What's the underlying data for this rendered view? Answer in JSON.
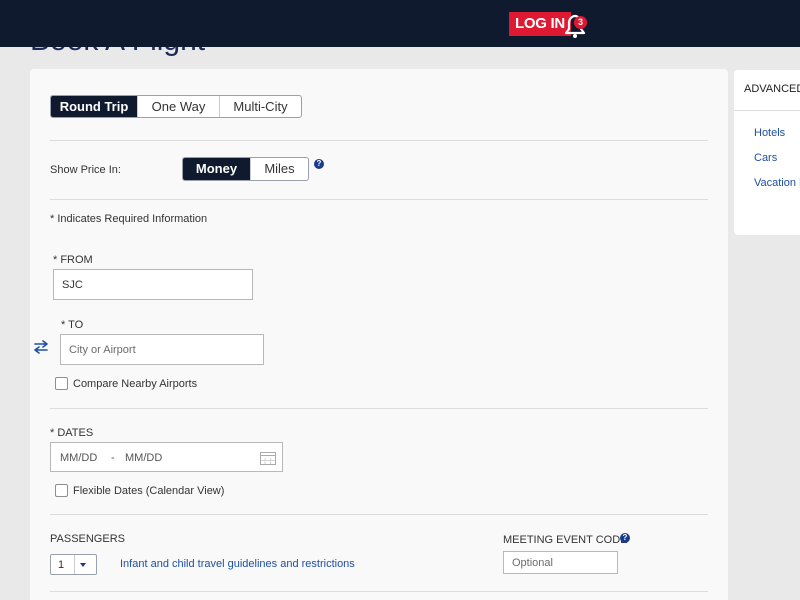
{
  "header": {
    "page_title": "Book A Flight",
    "login_label": "LOG IN",
    "notification_count": "3"
  },
  "trip_type": {
    "options": [
      "Round Trip",
      "One Way",
      "Multi-City"
    ],
    "selected": "Round Trip"
  },
  "price": {
    "label": "Show Price In:",
    "options": [
      "Money",
      "Miles"
    ],
    "selected": "Money"
  },
  "required_note": "* Indicates Required Information",
  "from": {
    "label": "* FROM",
    "value": "SJC"
  },
  "to": {
    "label": "* TO",
    "placeholder": "City or Airport"
  },
  "nearby_airports_label": "Compare Nearby Airports",
  "dates": {
    "label": "* DATES",
    "depart_placeholder": "MM/DD",
    "separator": "-",
    "return_placeholder": "MM/DD"
  },
  "flexible_dates_label": "Flexible Dates (Calendar View)",
  "passengers": {
    "label": "PASSENGERS",
    "value": "1",
    "guidelines_link": "Infant and child travel guidelines and restrictions"
  },
  "meeting_code": {
    "label": "MEETING EVENT CODE",
    "placeholder": "Optional"
  },
  "side_panel": {
    "title": "ADVANCED",
    "links": [
      "Hotels",
      "Cars",
      "Vacation P"
    ]
  },
  "colors": {
    "nav_background": "#101a2e",
    "accent_red": "#e01933",
    "link_blue": "#1e4fa3"
  }
}
